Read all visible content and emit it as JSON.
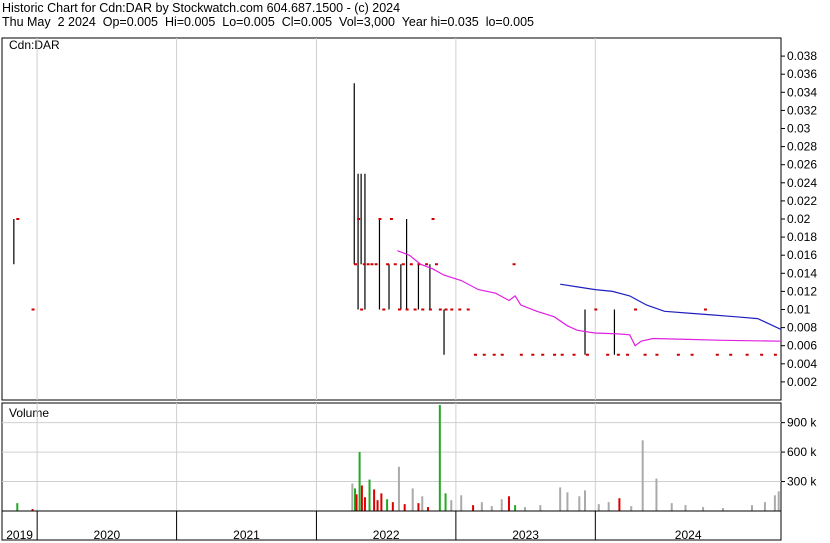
{
  "header": {
    "line1": "Historic Chart for Cdn:DAR by Stockwatch.com 604.687.1500 - (c) 2024",
    "line2": "Thu May  2 2024  Op=0.005  Hi=0.005  Lo=0.005  Cl=0.005  Vol=3,000  Year hi=0.035  lo=0.005"
  },
  "colors": {
    "price_bar": "#000000",
    "close_tick": "#cc0000",
    "ma_short": "#e020e0",
    "ma_long": "#2020c0",
    "vol_up": "#22aa22",
    "vol_down": "#dd0000",
    "vol_neutral": "#aaaaaa",
    "grid": "#cfcfcf"
  },
  "chart_data": [
    {
      "type": "line",
      "panel": "price",
      "label": "Cdn:DAR",
      "ylim": [
        0,
        0.04
      ],
      "y_ticks": [
        "0.002",
        "0.004",
        "0.006",
        "0.008",
        "0.01",
        "0.012",
        "0.014",
        "0.016",
        "0.018",
        "0.02",
        "0.022",
        "0.024",
        "0.026",
        "0.028",
        "0.03",
        "0.032",
        "0.034",
        "0.036",
        "0.038"
      ],
      "x_domain": [
        "2018-10",
        "2024-05"
      ],
      "price_bars": [
        {
          "x": "2018-11",
          "hi": 0.02,
          "lo": 0.015
        },
        {
          "x": "2021-04-10",
          "hi": 0.035,
          "lo": 0.015
        },
        {
          "x": "2021-04-20",
          "hi": 0.025,
          "lo": 0.01
        },
        {
          "x": "2021-04-28",
          "hi": 0.025,
          "lo": 0.015
        },
        {
          "x": "2021-05-08",
          "hi": 0.025,
          "lo": 0.01
        },
        {
          "x": "2021-06-15",
          "hi": 0.02,
          "lo": 0.01
        },
        {
          "x": "2021-07-10",
          "hi": 0.015,
          "lo": 0.01
        },
        {
          "x": "2021-08-10",
          "hi": 0.015,
          "lo": 0.01
        },
        {
          "x": "2021-08-25",
          "hi": 0.02,
          "lo": 0.01
        },
        {
          "x": "2021-09-25",
          "hi": 0.015,
          "lo": 0.01
        },
        {
          "x": "2021-10-25",
          "hi": 0.015,
          "lo": 0.01
        },
        {
          "x": "2021-12-01",
          "hi": 0.01,
          "lo": 0.005
        },
        {
          "x": "2022-12-05",
          "hi": 0.01,
          "lo": 0.005
        },
        {
          "x": "2023-02-20",
          "hi": 0.01,
          "lo": 0.005
        }
      ],
      "closes": [
        {
          "x": "2018-11-10",
          "y": 0.02
        },
        {
          "x": "2018-12-20",
          "y": 0.01
        },
        {
          "x": "2021-04-12",
          "y": 0.015
        },
        {
          "x": "2021-04-20",
          "y": 0.02
        },
        {
          "x": "2021-04-28",
          "y": 0.01
        },
        {
          "x": "2021-05-05",
          "y": 0.015
        },
        {
          "x": "2021-05-15",
          "y": 0.015
        },
        {
          "x": "2021-05-25",
          "y": 0.015
        },
        {
          "x": "2021-06-05",
          "y": 0.015
        },
        {
          "x": "2021-06-15",
          "y": 0.02
        },
        {
          "x": "2021-06-25",
          "y": 0.01
        },
        {
          "x": "2021-07-05",
          "y": 0.015
        },
        {
          "x": "2021-07-15",
          "y": 0.02
        },
        {
          "x": "2021-07-25",
          "y": 0.015
        },
        {
          "x": "2021-08-05",
          "y": 0.01
        },
        {
          "x": "2021-08-15",
          "y": 0.015
        },
        {
          "x": "2021-08-25",
          "y": 0.01
        },
        {
          "x": "2021-09-05",
          "y": 0.015
        },
        {
          "x": "2021-09-15",
          "y": 0.01
        },
        {
          "x": "2021-09-25",
          "y": 0.015
        },
        {
          "x": "2021-10-05",
          "y": 0.01
        },
        {
          "x": "2021-10-15",
          "y": 0.015
        },
        {
          "x": "2021-10-25",
          "y": 0.01
        },
        {
          "x": "2021-11-01",
          "y": 0.02
        },
        {
          "x": "2021-11-10",
          "y": 0.015
        },
        {
          "x": "2021-11-20",
          "y": 0.01
        },
        {
          "x": "2021-12-05",
          "y": 0.01
        },
        {
          "x": "2021-12-20",
          "y": 0.01
        },
        {
          "x": "2022-01-10",
          "y": 0.01
        },
        {
          "x": "2022-02-01",
          "y": 0.01
        },
        {
          "x": "2022-02-20",
          "y": 0.005
        },
        {
          "x": "2022-03-15",
          "y": 0.005
        },
        {
          "x": "2022-04-10",
          "y": 0.005
        },
        {
          "x": "2022-05-01",
          "y": 0.005
        },
        {
          "x": "2022-06-01",
          "y": 0.015
        },
        {
          "x": "2022-06-20",
          "y": 0.005
        },
        {
          "x": "2022-07-20",
          "y": 0.005
        },
        {
          "x": "2022-08-15",
          "y": 0.005
        },
        {
          "x": "2022-09-15",
          "y": 0.005
        },
        {
          "x": "2022-10-05",
          "y": 0.005
        },
        {
          "x": "2022-11-05",
          "y": 0.005
        },
        {
          "x": "2022-12-10",
          "y": 0.005
        },
        {
          "x": "2023-01-01",
          "y": 0.01
        },
        {
          "x": "2023-02-01",
          "y": 0.005
        },
        {
          "x": "2023-03-01",
          "y": 0.005
        },
        {
          "x": "2023-03-25",
          "y": 0.005
        },
        {
          "x": "2023-04-15",
          "y": 0.01
        },
        {
          "x": "2023-05-10",
          "y": 0.005
        },
        {
          "x": "2023-06-10",
          "y": 0.005
        },
        {
          "x": "2023-08-05",
          "y": 0.005
        },
        {
          "x": "2023-09-10",
          "y": 0.005
        },
        {
          "x": "2023-10-15",
          "y": 0.01
        },
        {
          "x": "2023-11-15",
          "y": 0.005
        },
        {
          "x": "2023-12-20",
          "y": 0.005
        },
        {
          "x": "2024-02-01",
          "y": 0.005
        },
        {
          "x": "2024-03-10",
          "y": 0.005
        },
        {
          "x": "2024-04-15",
          "y": 0.005
        }
      ],
      "series": [
        {
          "points": [
            {
              "x": "2021-08-01",
              "y": 0.0165
            },
            {
              "x": "2021-09-01",
              "y": 0.016
            },
            {
              "x": "2021-10-01",
              "y": 0.015
            },
            {
              "x": "2021-11-01",
              "y": 0.0145
            },
            {
              "x": "2021-12-01",
              "y": 0.0138
            },
            {
              "x": "2022-01-15",
              "y": 0.0132
            },
            {
              "x": "2022-03-01",
              "y": 0.0122
            },
            {
              "x": "2022-04-15",
              "y": 0.0118
            },
            {
              "x": "2022-05-20",
              "y": 0.011
            },
            {
              "x": "2022-06-05",
              "y": 0.0115
            },
            {
              "x": "2022-06-20",
              "y": 0.0105
            },
            {
              "x": "2022-08-01",
              "y": 0.0098
            },
            {
              "x": "2022-09-15",
              "y": 0.0092
            },
            {
              "x": "2022-10-20",
              "y": 0.0082
            },
            {
              "x": "2022-11-15",
              "y": 0.0077
            },
            {
              "x": "2022-12-31",
              "y": 0.0074
            },
            {
              "x": "2023-03-01",
              "y": 0.0073
            },
            {
              "x": "2023-04-01",
              "y": 0.0072
            },
            {
              "x": "2023-04-15",
              "y": 0.006
            },
            {
              "x": "2023-05-01",
              "y": 0.0065
            },
            {
              "x": "2023-06-01",
              "y": 0.0068
            },
            {
              "x": "2023-09-01",
              "y": 0.0067
            },
            {
              "x": "2023-12-01",
              "y": 0.0066
            },
            {
              "x": "2024-05-01",
              "y": 0.0065
            }
          ]
        },
        {
          "points": [
            {
              "x": "2022-10-01",
              "y": 0.0128
            },
            {
              "x": "2022-11-15",
              "y": 0.0125
            },
            {
              "x": "2023-01-01",
              "y": 0.0122
            },
            {
              "x": "2023-02-15",
              "y": 0.012
            },
            {
              "x": "2023-04-01",
              "y": 0.0115
            },
            {
              "x": "2023-05-15",
              "y": 0.0105
            },
            {
              "x": "2023-07-01",
              "y": 0.0098
            },
            {
              "x": "2023-09-01",
              "y": 0.0096
            },
            {
              "x": "2023-11-01",
              "y": 0.0094
            },
            {
              "x": "2024-01-01",
              "y": 0.0092
            },
            {
              "x": "2024-03-01",
              "y": 0.009
            },
            {
              "x": "2024-05-01",
              "y": 0.0078
            }
          ]
        }
      ]
    },
    {
      "type": "bar",
      "panel": "volume",
      "label": "Volume",
      "ylim": [
        0,
        1100000
      ],
      "y_ticks": [
        "300 k",
        "600 k",
        "900 k"
      ],
      "bars": [
        {
          "x": "2018-11-10",
          "v": 80000,
          "c": "up"
        },
        {
          "x": "2018-12-20",
          "v": 20000,
          "c": "down"
        },
        {
          "x": "2021-04-05",
          "v": 280000,
          "c": "neutral"
        },
        {
          "x": "2021-04-12",
          "v": 230000,
          "c": "up"
        },
        {
          "x": "2021-04-16",
          "v": 170000,
          "c": "down"
        },
        {
          "x": "2021-04-24",
          "v": 600000,
          "c": "up"
        },
        {
          "x": "2021-04-30",
          "v": 260000,
          "c": "down"
        },
        {
          "x": "2021-05-08",
          "v": 140000,
          "c": "down"
        },
        {
          "x": "2021-05-20",
          "v": 320000,
          "c": "up"
        },
        {
          "x": "2021-06-01",
          "v": 220000,
          "c": "down"
        },
        {
          "x": "2021-06-10",
          "v": 110000,
          "c": "down"
        },
        {
          "x": "2021-06-20",
          "v": 180000,
          "c": "down"
        },
        {
          "x": "2021-07-05",
          "v": 120000,
          "c": "up"
        },
        {
          "x": "2021-07-20",
          "v": 90000,
          "c": "down"
        },
        {
          "x": "2021-08-05",
          "v": 450000,
          "c": "neutral"
        },
        {
          "x": "2021-08-20",
          "v": 70000,
          "c": "down"
        },
        {
          "x": "2021-09-10",
          "v": 230000,
          "c": "neutral"
        },
        {
          "x": "2021-09-25",
          "v": 80000,
          "c": "down"
        },
        {
          "x": "2021-10-05",
          "v": 150000,
          "c": "neutral"
        },
        {
          "x": "2021-10-20",
          "v": 40000,
          "c": "down"
        },
        {
          "x": "2021-11-20",
          "v": 1080000,
          "c": "up"
        },
        {
          "x": "2021-12-05",
          "v": 180000,
          "c": "up"
        },
        {
          "x": "2021-12-20",
          "v": 110000,
          "c": "neutral"
        },
        {
          "x": "2022-01-15",
          "v": 160000,
          "c": "neutral"
        },
        {
          "x": "2022-02-15",
          "v": 60000,
          "c": "down"
        },
        {
          "x": "2022-03-10",
          "v": 90000,
          "c": "neutral"
        },
        {
          "x": "2022-04-05",
          "v": 50000,
          "c": "neutral"
        },
        {
          "x": "2022-05-01",
          "v": 120000,
          "c": "neutral"
        },
        {
          "x": "2022-05-20",
          "v": 150000,
          "c": "down"
        },
        {
          "x": "2022-06-05",
          "v": 60000,
          "c": "up"
        },
        {
          "x": "2022-07-01",
          "v": 40000,
          "c": "neutral"
        },
        {
          "x": "2022-08-10",
          "v": 60000,
          "c": "neutral"
        },
        {
          "x": "2022-10-01",
          "v": 240000,
          "c": "neutral"
        },
        {
          "x": "2022-10-20",
          "v": 190000,
          "c": "neutral"
        },
        {
          "x": "2022-11-20",
          "v": 150000,
          "c": "neutral"
        },
        {
          "x": "2022-12-05",
          "v": 210000,
          "c": "neutral"
        },
        {
          "x": "2023-01-10",
          "v": 70000,
          "c": "neutral"
        },
        {
          "x": "2023-02-05",
          "v": 90000,
          "c": "neutral"
        },
        {
          "x": "2023-03-05",
          "v": 130000,
          "c": "down"
        },
        {
          "x": "2023-04-05",
          "v": 50000,
          "c": "neutral"
        },
        {
          "x": "2023-05-05",
          "v": 720000,
          "c": "neutral"
        },
        {
          "x": "2023-06-10",
          "v": 330000,
          "c": "neutral"
        },
        {
          "x": "2023-07-20",
          "v": 80000,
          "c": "neutral"
        },
        {
          "x": "2023-08-25",
          "v": 60000,
          "c": "neutral"
        },
        {
          "x": "2023-10-10",
          "v": 40000,
          "c": "neutral"
        },
        {
          "x": "2023-12-01",
          "v": 30000,
          "c": "neutral"
        },
        {
          "x": "2024-02-15",
          "v": 60000,
          "c": "neutral"
        },
        {
          "x": "2024-03-20",
          "v": 90000,
          "c": "neutral"
        },
        {
          "x": "2024-04-15",
          "v": 160000,
          "c": "neutral"
        },
        {
          "x": "2024-04-25",
          "v": 200000,
          "c": "neutral"
        }
      ]
    }
  ],
  "x_axis": {
    "years": [
      {
        "label": "2019",
        "start": "2018-10",
        "end": "2019-01"
      },
      {
        "label": "2020",
        "start": "2019-01",
        "end": "2020-01"
      },
      {
        "label": "2021",
        "start": "2020-01",
        "end": "2021-01"
      },
      {
        "label": "2022",
        "start": "2021-01",
        "end": "2022-01"
      },
      {
        "label": "2023",
        "start": "2022-01",
        "end": "2023-01"
      },
      {
        "label": "2024",
        "start": "2023-01",
        "end": "2024-05"
      }
    ]
  }
}
